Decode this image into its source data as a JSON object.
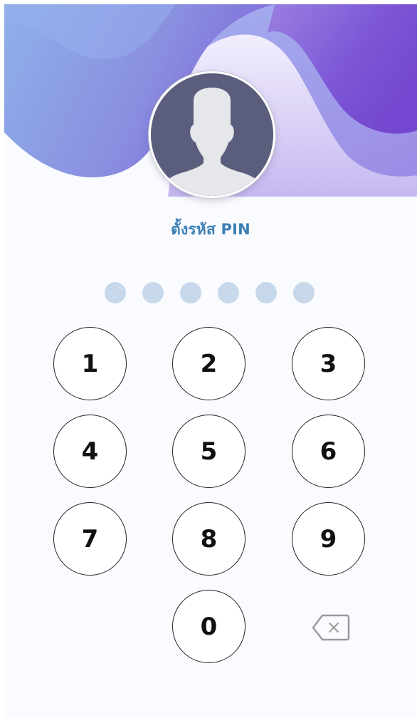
{
  "header": {
    "title": "ตั้งรหัส PIN"
  },
  "avatar": {
    "icon": "user-silhouette-icon"
  },
  "pin": {
    "length": 6,
    "filled": 0
  },
  "keypad": {
    "keys": [
      "1",
      "2",
      "3",
      "4",
      "5",
      "6",
      "7",
      "8",
      "9",
      "0"
    ],
    "backspace_icon": "backspace-icon"
  },
  "colors": {
    "accent_text": "#3a7fb5",
    "pin_dot_empty": "#c7d8ea",
    "wave_light": "#a9b9ef",
    "wave_dark": "#7a4fd4",
    "avatar_bg": "#5a5e7c"
  }
}
